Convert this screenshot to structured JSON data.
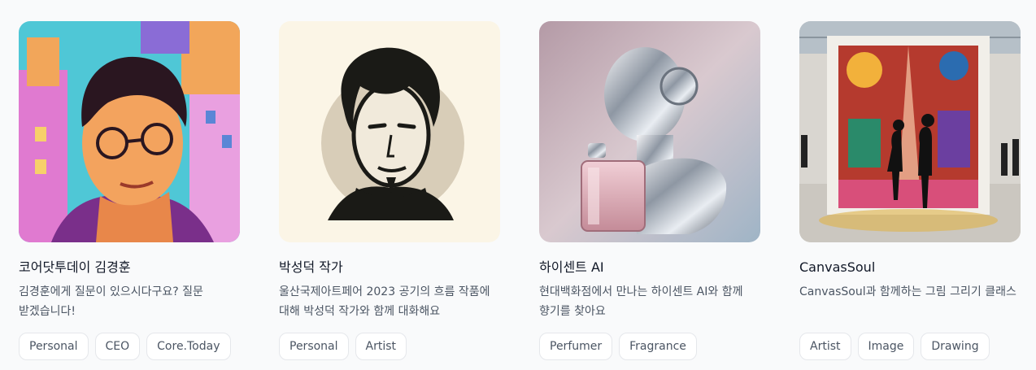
{
  "cards": [
    {
      "title": "코어닷투데이 김경훈",
      "description": "김경훈에게 질문이 있으시다구요? 질문 받겠습니다!",
      "image_icon": "avatar-portrait-illustration",
      "tags": [
        "Personal",
        "CEO",
        "Core.Today"
      ]
    },
    {
      "title": "박성덕 작가",
      "description": "울산국제아트페어 2023 공기의 흐름 작품에 대해 박성덕 작가와 함께 대화해요",
      "image_icon": "avatar-ink-portrait",
      "tags": [
        "Personal",
        "Artist"
      ]
    },
    {
      "title": "하이센트 AI",
      "description": "현대백화점에서 만나는 하이센트 AI와 함께 향기를 찾아요",
      "image_icon": "robot-perfume-illustration",
      "tags": [
        "Perfumer",
        "Fragrance"
      ]
    },
    {
      "title": "CanvasSoul",
      "description": "CanvasSoul과 함께하는 그림 그리기 클래스",
      "image_icon": "gallery-painting-illustration",
      "tags": [
        "Artist",
        "Image",
        "Drawing"
      ]
    }
  ],
  "colors": {
    "background": "#f9fafb",
    "tag_border": "#e5e7eb",
    "text_primary": "#111827",
    "text_secondary": "#4b5563"
  }
}
